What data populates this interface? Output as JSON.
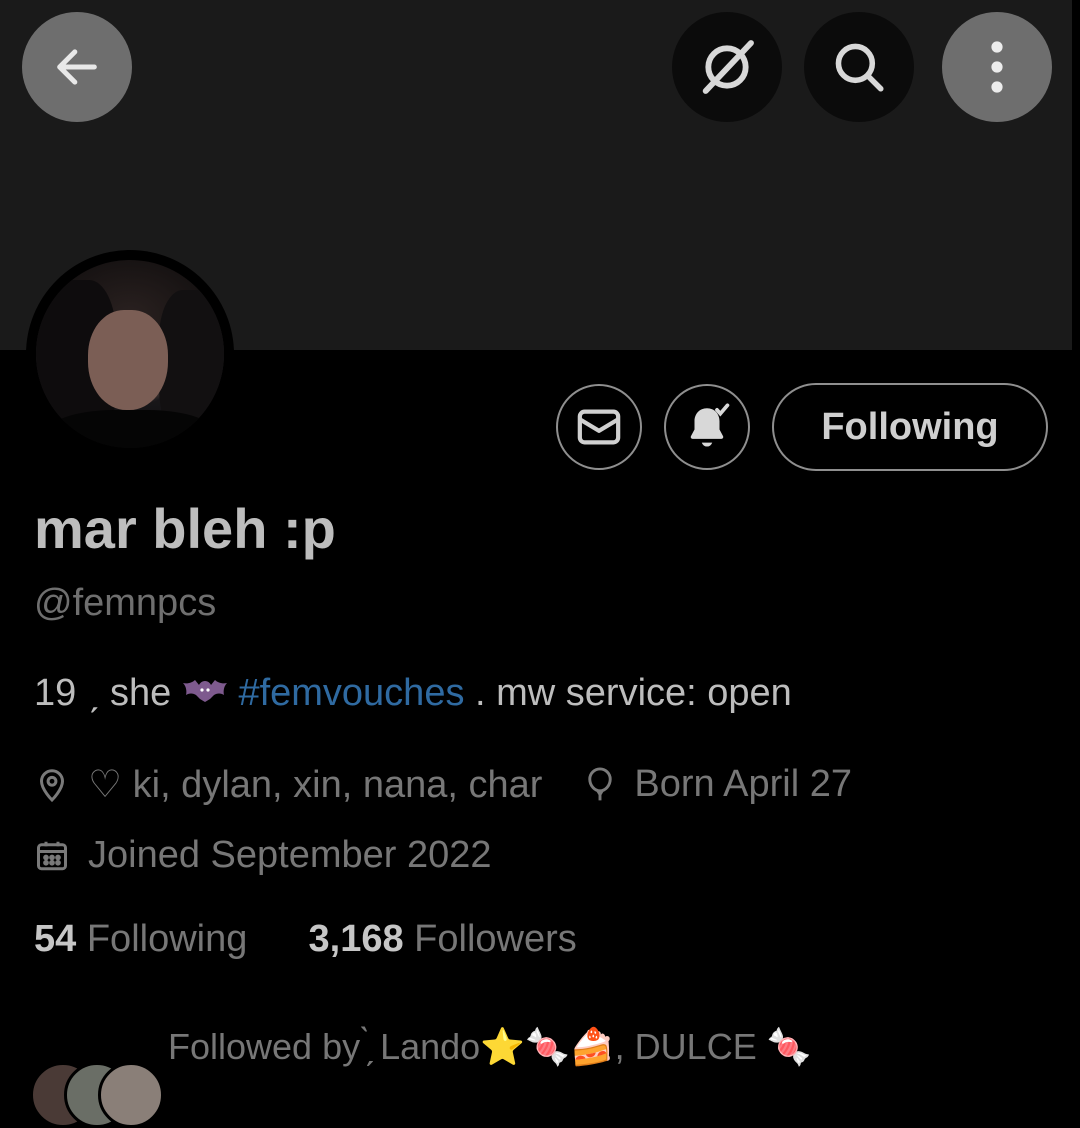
{
  "header": {
    "back_icon": "arrow-left-icon",
    "grok_icon": "grok-slash-icon",
    "search_icon": "search-icon",
    "more_icon": "more-vertical-icon"
  },
  "actions": {
    "message_icon": "envelope-icon",
    "notify_icon": "bell-check-icon",
    "following_label": "Following"
  },
  "profile": {
    "name": "mar bleh :p",
    "handle": "@femnpcs",
    "bio_pre": "19 ˏ she ",
    "bio_hashtag": "#femvouches",
    "bio_post": " .  mw service: open",
    "location": "♡  ki, dylan, xin, nana, char",
    "birthday": "Born April 27",
    "joined": "Joined September 2022",
    "following_count": "54",
    "following_label": "Following",
    "followers_count": "3,168",
    "followers_label": "Followers",
    "followed_by": "Followed by ̗̀ Lando⭐🍬🍰, DULCE 🍬"
  },
  "colors": {
    "background": "#000000",
    "banner": "#1a1a1a",
    "hashtag": "#2f6aa1",
    "muted": "#777777"
  }
}
